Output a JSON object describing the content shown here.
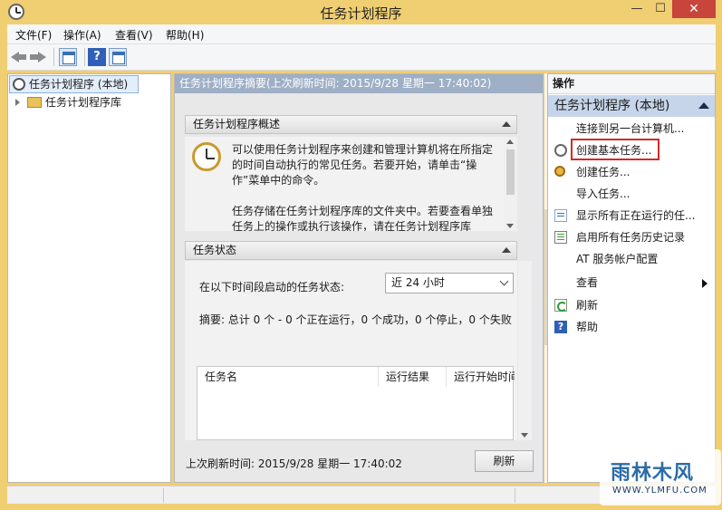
{
  "window": {
    "title": "任务计划程序",
    "min": "—",
    "max": "☐",
    "close": "✕"
  },
  "menu": [
    "文件(F)",
    "操作(A)",
    "查看(V)",
    "帮助(H)"
  ],
  "toolbar": {
    "help_glyph": "?"
  },
  "tree": {
    "root": "任务计划程序 (本地)",
    "child": "任务计划程序库"
  },
  "center": {
    "header": "任务计划程序摘要(上次刷新时间: 2015/9/28 星期一 17:40:02)",
    "overview_title": "任务计划程序概述",
    "overview_p1": "可以使用任务计划程序来创建和管理计算机将在所指定的时间自动执行的常见任务。若要开始，请单击“操作”菜单中的命令。",
    "overview_p2": "任务存储在任务计划程序库的文件夹中。若要查看单独任务上的操作或执行该操作，请在任务计划程序库",
    "status_title": "任务状态",
    "status_label": "在以下时间段启动的任务状态:",
    "status_range": "近 24 小时",
    "summary": "摘要: 总计 0 个 - 0 个正在运行，0 个成功，0 个停止，0 个失败",
    "columns": [
      "任务名",
      "运行结果",
      "运行开始时间"
    ],
    "last_refresh": "上次刷新时间: 2015/9/28 星期一 17:40:02",
    "refresh_button": "刷新"
  },
  "actions": {
    "header": "操作",
    "group": "任务计划程序 (本地)",
    "items": [
      "连接到另一台计算机...",
      "创建基本任务...",
      "创建任务...",
      "导入任务...",
      "显示所有正在运行的任...",
      "启用所有任务历史记录",
      "AT 服务帐户配置",
      "查看",
      "刷新",
      "帮助"
    ]
  },
  "watermark": {
    "main": "雨林木风",
    "sub": "WWW.YLMFU.COM"
  }
}
